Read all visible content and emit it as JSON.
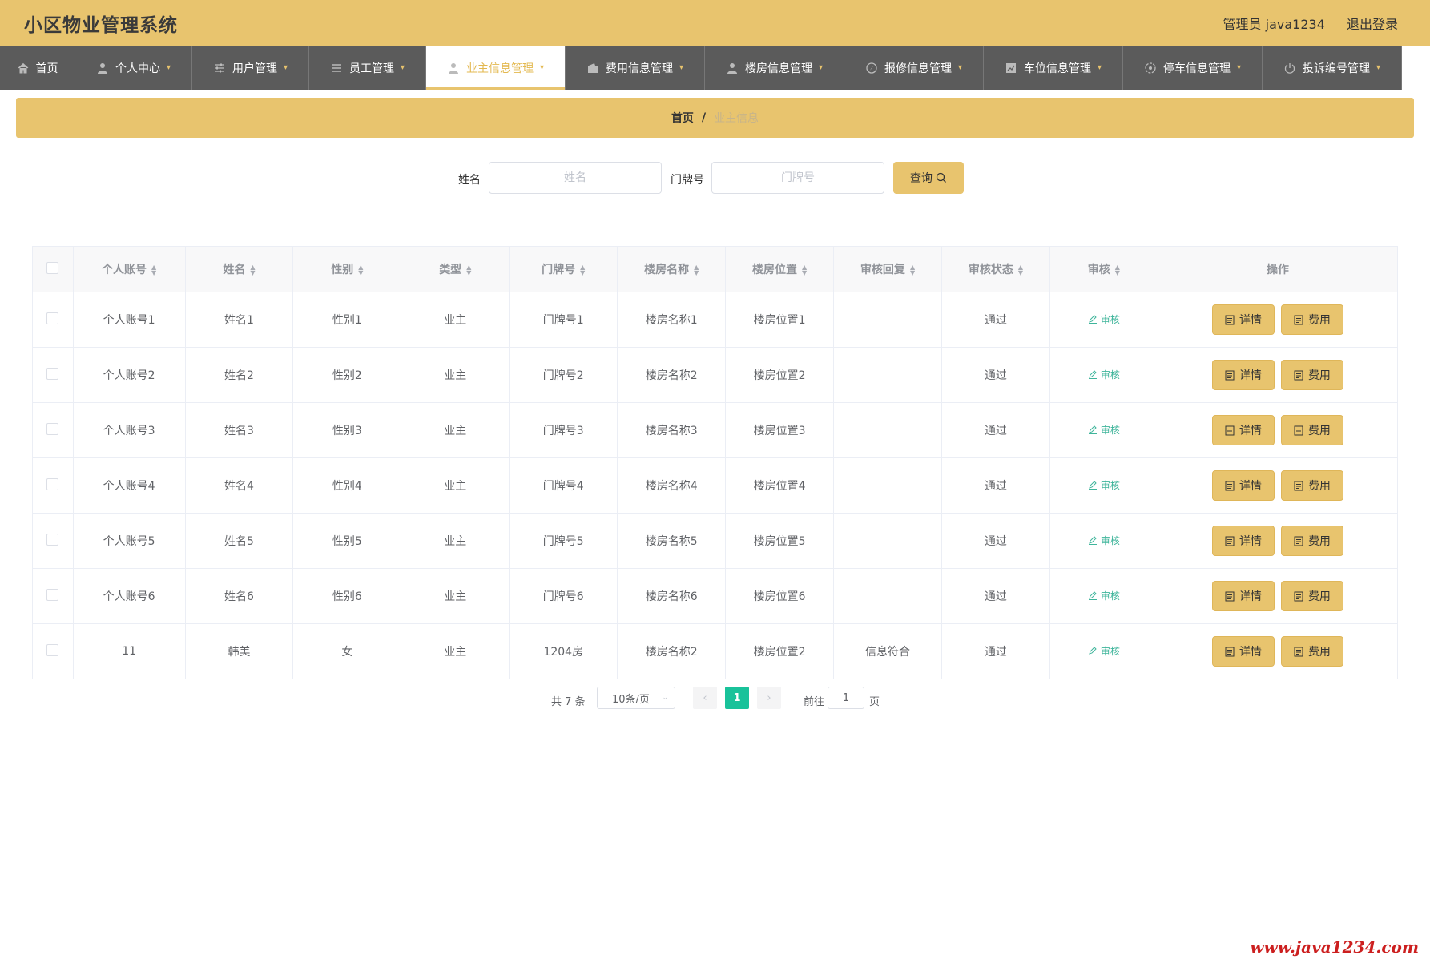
{
  "header": {
    "title": "小区物业管理系统",
    "user": "管理员 java1234",
    "logout": "退出登录"
  },
  "nav": [
    {
      "label": "首页",
      "icon": "home-icon",
      "caret": false,
      "active": false
    },
    {
      "label": "个人中心",
      "icon": "user-icon",
      "caret": true,
      "active": false
    },
    {
      "label": "用户管理",
      "icon": "sliders-icon",
      "caret": true,
      "active": false
    },
    {
      "label": "员工管理",
      "icon": "list-icon",
      "caret": true,
      "active": false
    },
    {
      "label": "业主信息管理",
      "icon": "user-icon",
      "caret": true,
      "active": true
    },
    {
      "label": "费用信息管理",
      "icon": "wallet-icon",
      "caret": true,
      "active": false
    },
    {
      "label": "楼房信息管理",
      "icon": "user-icon",
      "caret": true,
      "active": false
    },
    {
      "label": "报修信息管理",
      "icon": "compass-icon",
      "caret": true,
      "active": false
    },
    {
      "label": "车位信息管理",
      "icon": "chart-icon",
      "caret": true,
      "active": false
    },
    {
      "label": "停车信息管理",
      "icon": "gear-circle-icon",
      "caret": true,
      "active": false
    },
    {
      "label": "投诉编号管理",
      "icon": "power-icon",
      "caret": true,
      "active": false
    }
  ],
  "breadcrumb": {
    "home": "首页",
    "sep": "/",
    "current": "业主信息"
  },
  "search": {
    "name_label": "姓名",
    "name_placeholder": "姓名",
    "door_label": "门牌号",
    "door_placeholder": "门牌号",
    "query_label": "查询"
  },
  "table": {
    "columns": [
      "个人账号",
      "姓名",
      "性别",
      "类型",
      "门牌号",
      "楼房名称",
      "楼房位置",
      "审核回复",
      "审核状态",
      "审核",
      "操作"
    ],
    "audit_link": "审核",
    "detail_btn": "详情",
    "fee_btn": "费用",
    "rows": [
      [
        "个人账号1",
        "姓名1",
        "性别1",
        "业主",
        "门牌号1",
        "楼房名称1",
        "楼房位置1",
        "",
        "通过"
      ],
      [
        "个人账号2",
        "姓名2",
        "性别2",
        "业主",
        "门牌号2",
        "楼房名称2",
        "楼房位置2",
        "",
        "通过"
      ],
      [
        "个人账号3",
        "姓名3",
        "性别3",
        "业主",
        "门牌号3",
        "楼房名称3",
        "楼房位置3",
        "",
        "通过"
      ],
      [
        "个人账号4",
        "姓名4",
        "性别4",
        "业主",
        "门牌号4",
        "楼房名称4",
        "楼房位置4",
        "",
        "通过"
      ],
      [
        "个人账号5",
        "姓名5",
        "性别5",
        "业主",
        "门牌号5",
        "楼房名称5",
        "楼房位置5",
        "",
        "通过"
      ],
      [
        "个人账号6",
        "姓名6",
        "性别6",
        "业主",
        "门牌号6",
        "楼房名称6",
        "楼房位置6",
        "",
        "通过"
      ],
      [
        "11",
        "韩美",
        "女",
        "业主",
        "1204房",
        "楼房名称2",
        "楼房位置2",
        "信息符合",
        "通过"
      ]
    ]
  },
  "pagination": {
    "total": "共 7 条",
    "page_size": "10条/页",
    "current": "1",
    "goto": "前往",
    "goto_value": "1",
    "page_unit": "页"
  },
  "watermark": "www.java1234.com",
  "colors": {
    "brand": "#e8c46e",
    "nav_bg": "#5b5b5b",
    "page_active": "#19c29a",
    "audit": "#3fb59b"
  }
}
